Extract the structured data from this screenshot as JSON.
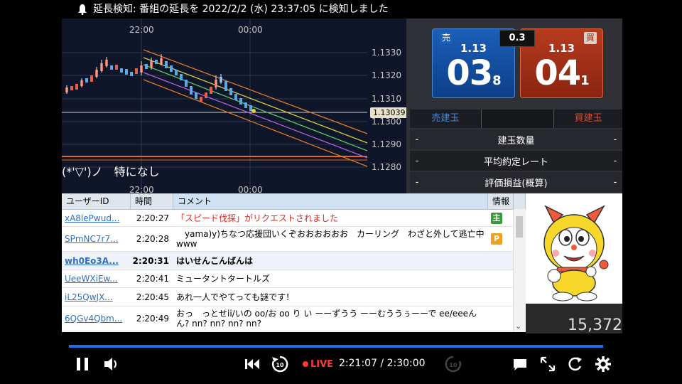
{
  "notification": {
    "text": "延長検知: 番組の延長を 2022/2/2 (水) 23:37:05 に検知しました"
  },
  "chart": {
    "time_top": [
      "22:00",
      "00:00"
    ],
    "time_bottom": [
      "22:00",
      "00:00"
    ],
    "price_ticks": [
      "1.1330",
      "1.1320",
      "1.1310",
      "1.1300",
      "1.1290",
      "1.1280"
    ],
    "current_price": "1.13039",
    "overlay_text": "(*'▽')ノ　特になし"
  },
  "trade": {
    "sell": {
      "tag": "売",
      "prefix": "1.13",
      "big": "03",
      "small": "8"
    },
    "buy": {
      "tag": "買",
      "prefix": "1.13",
      "big": "04",
      "small": "1"
    },
    "spread": "0.3",
    "sell_pos_label": "売建玉",
    "buy_pos_label": "買建玉",
    "rows": [
      {
        "left": "-",
        "label": "建玉数量",
        "right": "-"
      },
      {
        "left": "-",
        "label": "平均約定レート",
        "right": "-"
      },
      {
        "left": "-",
        "label": "評価損益(概算)",
        "right": "-"
      }
    ]
  },
  "comments": {
    "headers": [
      "ユーザーID",
      "時間",
      "コメント",
      "情報"
    ],
    "rows": [
      {
        "user": "xA8lePwud...",
        "time": "2:20:27",
        "text": "「スピード伐採」がリクエストされました",
        "info": "主",
        "bold": false,
        "red": true
      },
      {
        "user": "SPmNC7r7...",
        "time": "2:20:28",
        "text": "　yama)y)ちなつ応援団いくぞおおおおおお　カーリング　わざと外して逃亡中www",
        "info": "P",
        "bold": false,
        "red": false
      },
      {
        "user": "wh0Eo3A...",
        "time": "2:20:31",
        "text": "はいせんこんばんは",
        "info": "",
        "bold": true,
        "red": false
      },
      {
        "user": "UeeWXiEw...",
        "time": "2:20:41",
        "text": "ミュータントタートルズ",
        "info": "",
        "bold": false,
        "red": false
      },
      {
        "user": "iL25QwJX...",
        "time": "2:20:45",
        "text": "あれ一人でやてっても謎です！",
        "info": "",
        "bold": false,
        "red": false
      },
      {
        "user": "6QGv4Qbm...",
        "time": "2:20:49",
        "text": "おっ　っとせii/いの oo/お oo り い ーーずうう ーーむううぅーーで ee/eeeんん? nn? nn? nn? nn?",
        "info": "",
        "bold": false,
        "red": false
      }
    ]
  },
  "viewers": "15,372",
  "player": {
    "live": "LIVE",
    "time": "2:21:07 / 2:30:00",
    "progress": 0.977,
    "skip_label": "10"
  },
  "colors": {
    "accent": "#1e6fe8",
    "live": "#ff3b30",
    "sell": "#1a5fb8",
    "buy": "#b63b1e"
  }
}
